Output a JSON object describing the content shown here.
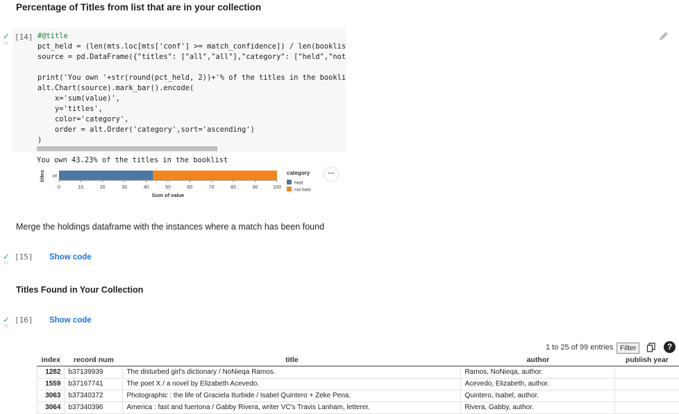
{
  "section1": {
    "title": "Percentage of Titles from list that are in your collection"
  },
  "cell14": {
    "prompt": "[14]",
    "code_lines": [
      "#@title",
      "pct_held = (len(mts.loc[mts['conf'] >= match_confidence]) / len(booklist",
      "source = pd.DataFrame({\"titles\": [\"all\",\"all\"],\"category\": [\"held\",\"not",
      "",
      "print('You own '+str(round(pct_held, 2))+'% of the titles in the booklis",
      "alt.Chart(source).mark_bar().encode(",
      "    x='sum(value)',",
      "    y='titles',",
      "    color='category',",
      "    order = alt.Order('category',sort='ascending')",
      ")"
    ],
    "output_text": "You own 43.23% of the titles in the booklist",
    "subtext": "0s"
  },
  "chart_data": {
    "type": "bar",
    "orientation": "horizontal-stacked",
    "categories": [
      "all"
    ],
    "series": [
      {
        "name": "held",
        "values": [
          43.23
        ],
        "color": "#4c78a8"
      },
      {
        "name": "not held",
        "values": [
          56.77
        ],
        "color": "#f58518"
      }
    ],
    "xlabel": "Sum of value",
    "ylabel": "titles",
    "xticks": [
      "0",
      "10",
      "20",
      "30",
      "40",
      "50",
      "60",
      "70",
      "80",
      "90",
      "100"
    ],
    "xlim": [
      0,
      100
    ],
    "legend_title": "category",
    "legend_placement": "right"
  },
  "section2": {
    "text": "Merge the holdings dataframe with the instances where a match has been found"
  },
  "cell15": {
    "prompt": "[15]",
    "show_code": "Show code",
    "subtext": "0s"
  },
  "section3": {
    "title": "Titles Found in Your Collection"
  },
  "cell16": {
    "prompt": "[16]",
    "show_code": "Show code",
    "subtext": "0s"
  },
  "table": {
    "pagination": "1 to 25 of 99 entries",
    "filter_label": "Filter",
    "help_label": "?",
    "headers": [
      "index",
      "record num",
      "title",
      "author",
      "publish year"
    ],
    "rows": [
      {
        "index": "1282",
        "record": "b37139939",
        "title": "The disturbed girl's dictionary / NoNieqa Ramos.",
        "author": "Ramos, NoNieqa, author.",
        "year": ""
      },
      {
        "index": "1559",
        "record": "b37167741",
        "title": "The poet X / a novel by Elizabeth Acevedo.",
        "author": "Acevedo, Elizabeth, author.",
        "year": ""
      },
      {
        "index": "3063",
        "record": "b37340372",
        "title": "Photographic : the life of Graciela Iturbide / Isabel Quintero + Zeke Pena.",
        "author": "Quintero, Isabel, author.",
        "year": ""
      },
      {
        "index": "3064",
        "record": "b37340396",
        "title": "America : fast and fuertona / Gabby Rivera, writer VC's Travis Lanham, letterer.",
        "author": "Rivera, Gabby, author.",
        "year": ""
      }
    ]
  }
}
